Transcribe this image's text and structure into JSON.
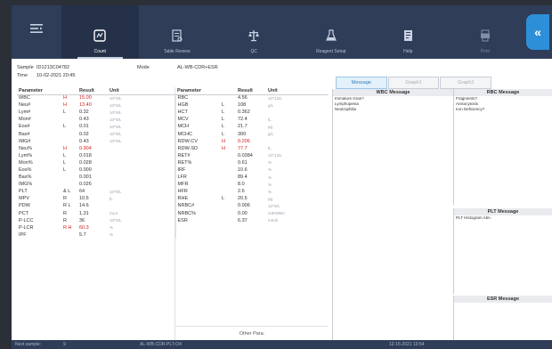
{
  "toolbar": {
    "menu_icon": "hamburger-icon",
    "items": [
      {
        "label": "Count",
        "icon": "count-icon",
        "active": true
      },
      {
        "label": "Table Review",
        "icon": "table-review-icon",
        "active": false
      },
      {
        "label": "QC",
        "icon": "qc-icon",
        "active": false
      },
      {
        "label": "Reagent Setup",
        "icon": "reagent-icon",
        "active": false
      },
      {
        "label": "Help",
        "icon": "help-icon",
        "active": false
      },
      {
        "label": "Print",
        "icon": "print-icon",
        "active": false
      }
    ],
    "collapse_glyph": "«",
    "colors": {
      "bar": "#2f3d58",
      "accent": "#2d8fd8"
    }
  },
  "sample": {
    "sample_label": "Sample",
    "sample_id": "ID1213C04782",
    "mode_label": "Mode",
    "mode_value": "AL-WB-CDR+ESR",
    "time_label": "Time",
    "time_value": "10-02-2021 20:45"
  },
  "table": {
    "headers": [
      "Parameter",
      "",
      "Result",
      "Unit",
      "Parameter",
      "",
      "Result",
      "Unit"
    ],
    "left": [
      {
        "param": "WBC",
        "flag": "H",
        "result": "15.00",
        "unit": "10^9/L",
        "red": true
      },
      {
        "param": "Neu#",
        "flag": "H",
        "result": "13.40",
        "unit": "10^9/L",
        "red": true
      },
      {
        "param": "Lym#",
        "flag": "L",
        "result": "0.32",
        "unit": "10^9/L",
        "red": false
      },
      {
        "param": "Mon#",
        "flag": "",
        "result": "0.43",
        "unit": "10^9/L",
        "red": false
      },
      {
        "param": "Eos#",
        "flag": "L",
        "result": "0.01",
        "unit": "10^9/L",
        "red": false
      },
      {
        "param": "Bas#",
        "flag": "",
        "result": "0.02",
        "unit": "10^9/L",
        "red": false
      },
      {
        "param": "IMG#",
        "flag": "",
        "result": "0.43",
        "unit": "10^9/L",
        "red": false
      },
      {
        "param": "Neu%",
        "flag": "H",
        "result": "0.904",
        "unit": "",
        "red": true
      },
      {
        "param": "Lym%",
        "flag": "L",
        "result": "0.018",
        "unit": "",
        "red": false
      },
      {
        "param": "Mon%",
        "flag": "L",
        "result": "0.028",
        "unit": "",
        "red": false
      },
      {
        "param": "Eos%",
        "flag": "L",
        "result": "0.000",
        "unit": "",
        "red": false
      },
      {
        "param": "Bas%",
        "flag": "",
        "result": "0.001",
        "unit": "",
        "red": false
      },
      {
        "param": "IMG%",
        "flag": "",
        "result": "0.026",
        "unit": "",
        "red": false
      },
      {
        "param": "PLT",
        "flag": "& L",
        "result": "64",
        "unit": "10^9/L",
        "red": false
      },
      {
        "param": "MPV",
        "flag": "R",
        "result": "10.5",
        "unit": "fL",
        "red": false
      },
      {
        "param": "PDW",
        "flag": "R L",
        "result": "14.6",
        "unit": "",
        "red": false
      },
      {
        "param": "PCT",
        "flag": "R",
        "result": "1.31",
        "unit": "mL/L",
        "red": false
      },
      {
        "param": "P-LCC",
        "flag": "R",
        "result": "36",
        "unit": "10^9/L",
        "red": false
      },
      {
        "param": "P-LCR",
        "flag": "R H",
        "result": "60.3",
        "unit": "%",
        "red": true
      },
      {
        "param": "IPF",
        "flag": "",
        "result": "5.7",
        "unit": "%",
        "red": false
      }
    ],
    "right": [
      {
        "param": "RBC",
        "flag": "",
        "result": "4.56",
        "unit": "10^12/L",
        "red": false
      },
      {
        "param": "HGB",
        "flag": "L",
        "result": "108",
        "unit": "g/L",
        "red": false
      },
      {
        "param": "HCT",
        "flag": "L",
        "result": "0.362",
        "unit": "",
        "red": false
      },
      {
        "param": "MCV",
        "flag": "L",
        "result": "72.4",
        "unit": "fL",
        "red": false
      },
      {
        "param": "MCH",
        "flag": "L",
        "result": "21.7",
        "unit": "pg",
        "red": false
      },
      {
        "param": "MCHC",
        "flag": "L",
        "result": "300",
        "unit": "g/L",
        "red": false
      },
      {
        "param": "RDW-CV",
        "flag": "H",
        "result": "0.206",
        "unit": "",
        "red": true
      },
      {
        "param": "RDW-SD",
        "flag": "H",
        "result": "77.7",
        "unit": "fL",
        "red": true
      },
      {
        "param": "RET#",
        "flag": "",
        "result": "0.0384",
        "unit": "10^12/L",
        "red": false
      },
      {
        "param": "RET%",
        "flag": "",
        "result": "0.61",
        "unit": "%",
        "red": false
      },
      {
        "param": "IRF",
        "flag": "",
        "result": "10.6",
        "unit": "%",
        "red": false
      },
      {
        "param": "LFR",
        "flag": "",
        "result": "89.4",
        "unit": "%",
        "red": false
      },
      {
        "param": "MFR",
        "flag": "",
        "result": "8.0",
        "unit": "%",
        "red": false
      },
      {
        "param": "HFR",
        "flag": "",
        "result": "2.6",
        "unit": "%",
        "red": false
      },
      {
        "param": "RHE",
        "flag": "L",
        "result": "20.5",
        "unit": "pg",
        "red": false
      },
      {
        "param": "NRBC#",
        "flag": "",
        "result": "0.006",
        "unit": "10^9/L",
        "red": false
      },
      {
        "param": "NRBC%",
        "flag": "",
        "result": "0.00",
        "unit": "/100WBC",
        "red": false
      },
      {
        "param": "ESR",
        "flag": "",
        "result": "6.37",
        "unit": "mm/h",
        "red": false
      }
    ],
    "other_params": "Other Para."
  },
  "tabs": [
    "Message",
    "Graph1",
    "Graph2"
  ],
  "messages": {
    "wbc_title": "WBC Message",
    "wbc_lines": [
      "Immature Gran?",
      "Lymphopenia",
      "Neutrophilia"
    ],
    "rbc_title": "RBC Message",
    "rbc_lines": [
      "Fragments?",
      "Anisocytosis",
      "Iron Deficiency?"
    ],
    "plt_title": "PLT Message",
    "plt_lines": [
      "PLT Histogram Abn."
    ],
    "esr_title": "ESR Message"
  },
  "status": {
    "next_label": "Next sample:",
    "next_value": "9",
    "mode": "AL-WB-CDR-PLT-O4",
    "datetime": "12-16-2021 10:54"
  }
}
